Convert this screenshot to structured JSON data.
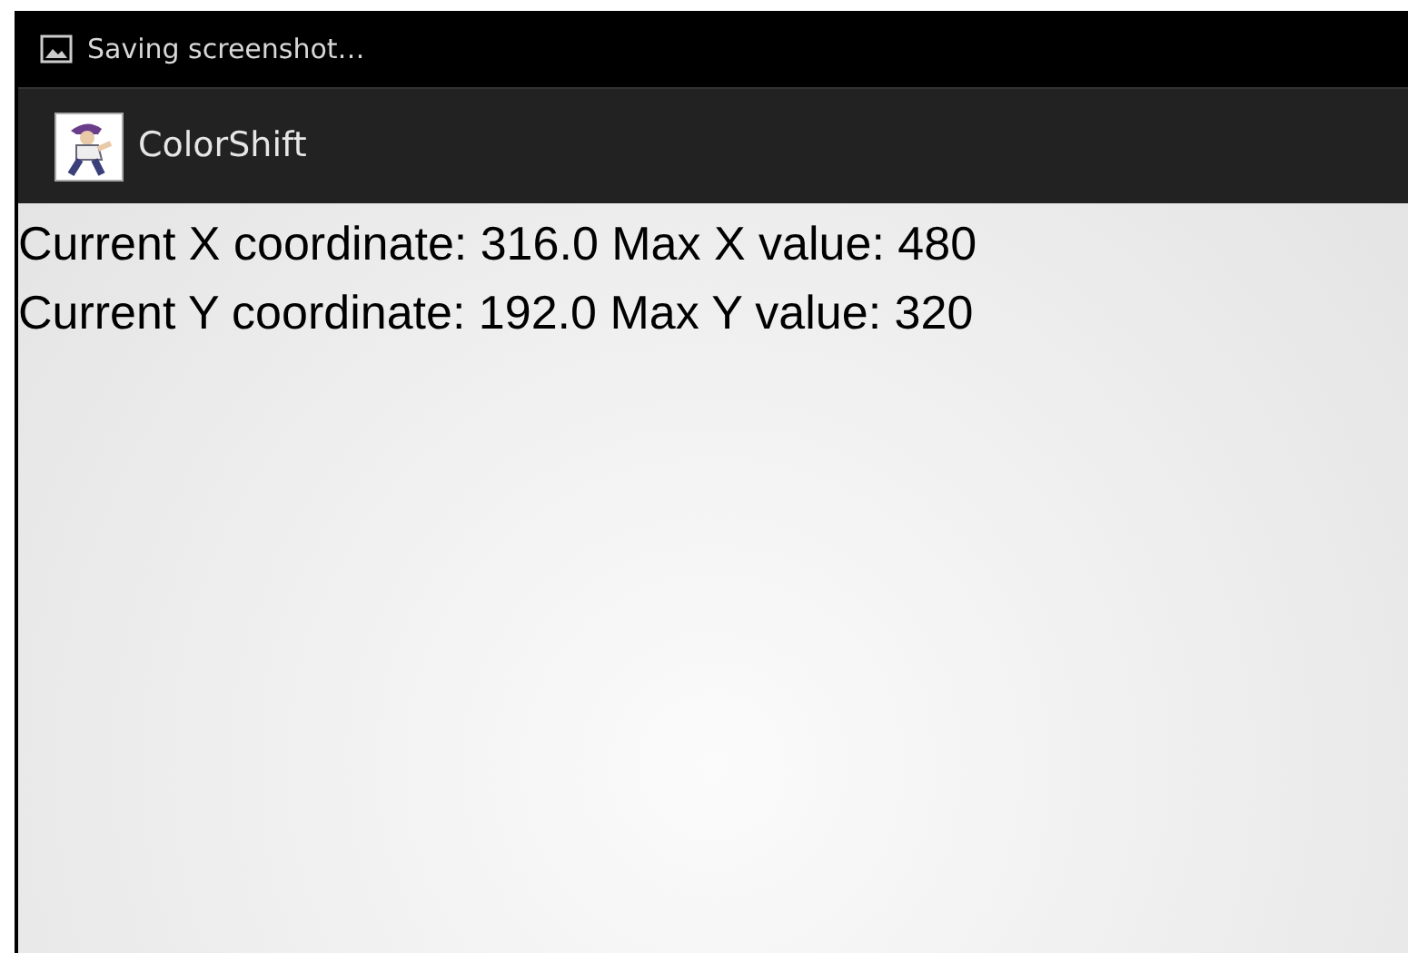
{
  "status_bar": {
    "notification": "Saving screenshot…"
  },
  "action_bar": {
    "title": "ColorShift"
  },
  "lines": [
    "Current X coordinate: 316.0 Max X value: 480",
    "Current Y coordinate: 192.0 Max Y value: 320"
  ]
}
